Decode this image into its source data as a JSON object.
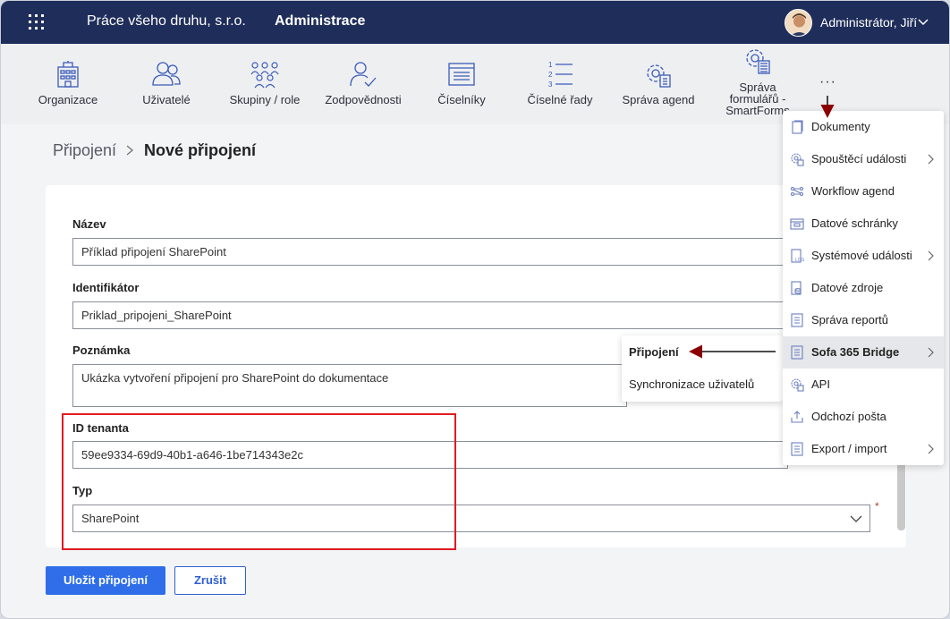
{
  "topbar": {
    "company": "Práce všeho druhu, s.r.o.",
    "section": "Administrace",
    "user": "Administrátor, Jiří"
  },
  "toolbar": {
    "items": [
      {
        "label": "Organizace",
        "icon": "building-icon"
      },
      {
        "label": "Uživatelé",
        "icon": "users-icon"
      },
      {
        "label": "Skupiny / role",
        "icon": "groups-icon"
      },
      {
        "label": "Zodpovědnosti",
        "icon": "user-check-icon"
      },
      {
        "label": "Číselníky",
        "icon": "list-window-icon"
      },
      {
        "label": "Číselné řady",
        "icon": "numbered-list-icon"
      },
      {
        "label": "Správa agend",
        "icon": "gear-doc-icon"
      },
      {
        "label": "Správa formulářů - SmartForms",
        "icon": "gear-form-icon"
      }
    ],
    "more": "···"
  },
  "breadcrumb": {
    "parent": "Připojení",
    "current": "Nové připojení"
  },
  "form": {
    "name_label": "Název",
    "name_value": "Příklad připojení SharePoint",
    "id_label": "Identifikátor",
    "id_value": "Priklad_pripojeni_SharePoint",
    "note_label": "Poznámka",
    "note_value": "Ukázka vytvoření připojení pro SharePoint do dokumentace",
    "tenant_label": "ID tenanta",
    "tenant_value": "59ee9334-69d9-40b1-a646-1be714343e2c",
    "type_label": "Typ",
    "type_value": "SharePoint",
    "required_mark": "*"
  },
  "buttons": {
    "save": "Uložit připojení",
    "cancel": "Zrušit"
  },
  "menu": {
    "items": [
      {
        "label": "Dokumenty",
        "icon": "document-icon",
        "submenu": false
      },
      {
        "label": "Spouštěcí události",
        "icon": "gear-trigger-icon",
        "submenu": true
      },
      {
        "label": "Workflow agend",
        "icon": "workflow-icon",
        "submenu": false
      },
      {
        "label": "Datové schránky",
        "icon": "databox-icon",
        "submenu": false
      },
      {
        "label": "Systémové události",
        "icon": "log-icon",
        "submenu": true
      },
      {
        "label": "Datové zdroje",
        "icon": "database-icon",
        "submenu": false
      },
      {
        "label": "Správa reportů",
        "icon": "report-icon",
        "submenu": false
      },
      {
        "label": "Sofa 365 Bridge",
        "icon": "bridge-icon",
        "submenu": true,
        "active": true
      },
      {
        "label": "API",
        "icon": "api-gear-icon",
        "submenu": false
      },
      {
        "label": "Odchozí pošta",
        "icon": "outbox-icon",
        "submenu": false
      },
      {
        "label": "Export / import",
        "icon": "export-icon",
        "submenu": true
      }
    ]
  },
  "submenu": {
    "items": [
      {
        "label": "Připojení",
        "bold": true
      },
      {
        "label": "Synchronizace uživatelů",
        "bold": false
      }
    ]
  },
  "colors": {
    "topbar": "#1f2d5a",
    "primary": "#2f6ee8",
    "highlight": "#e11b22",
    "icon": "#3a5bb8"
  }
}
